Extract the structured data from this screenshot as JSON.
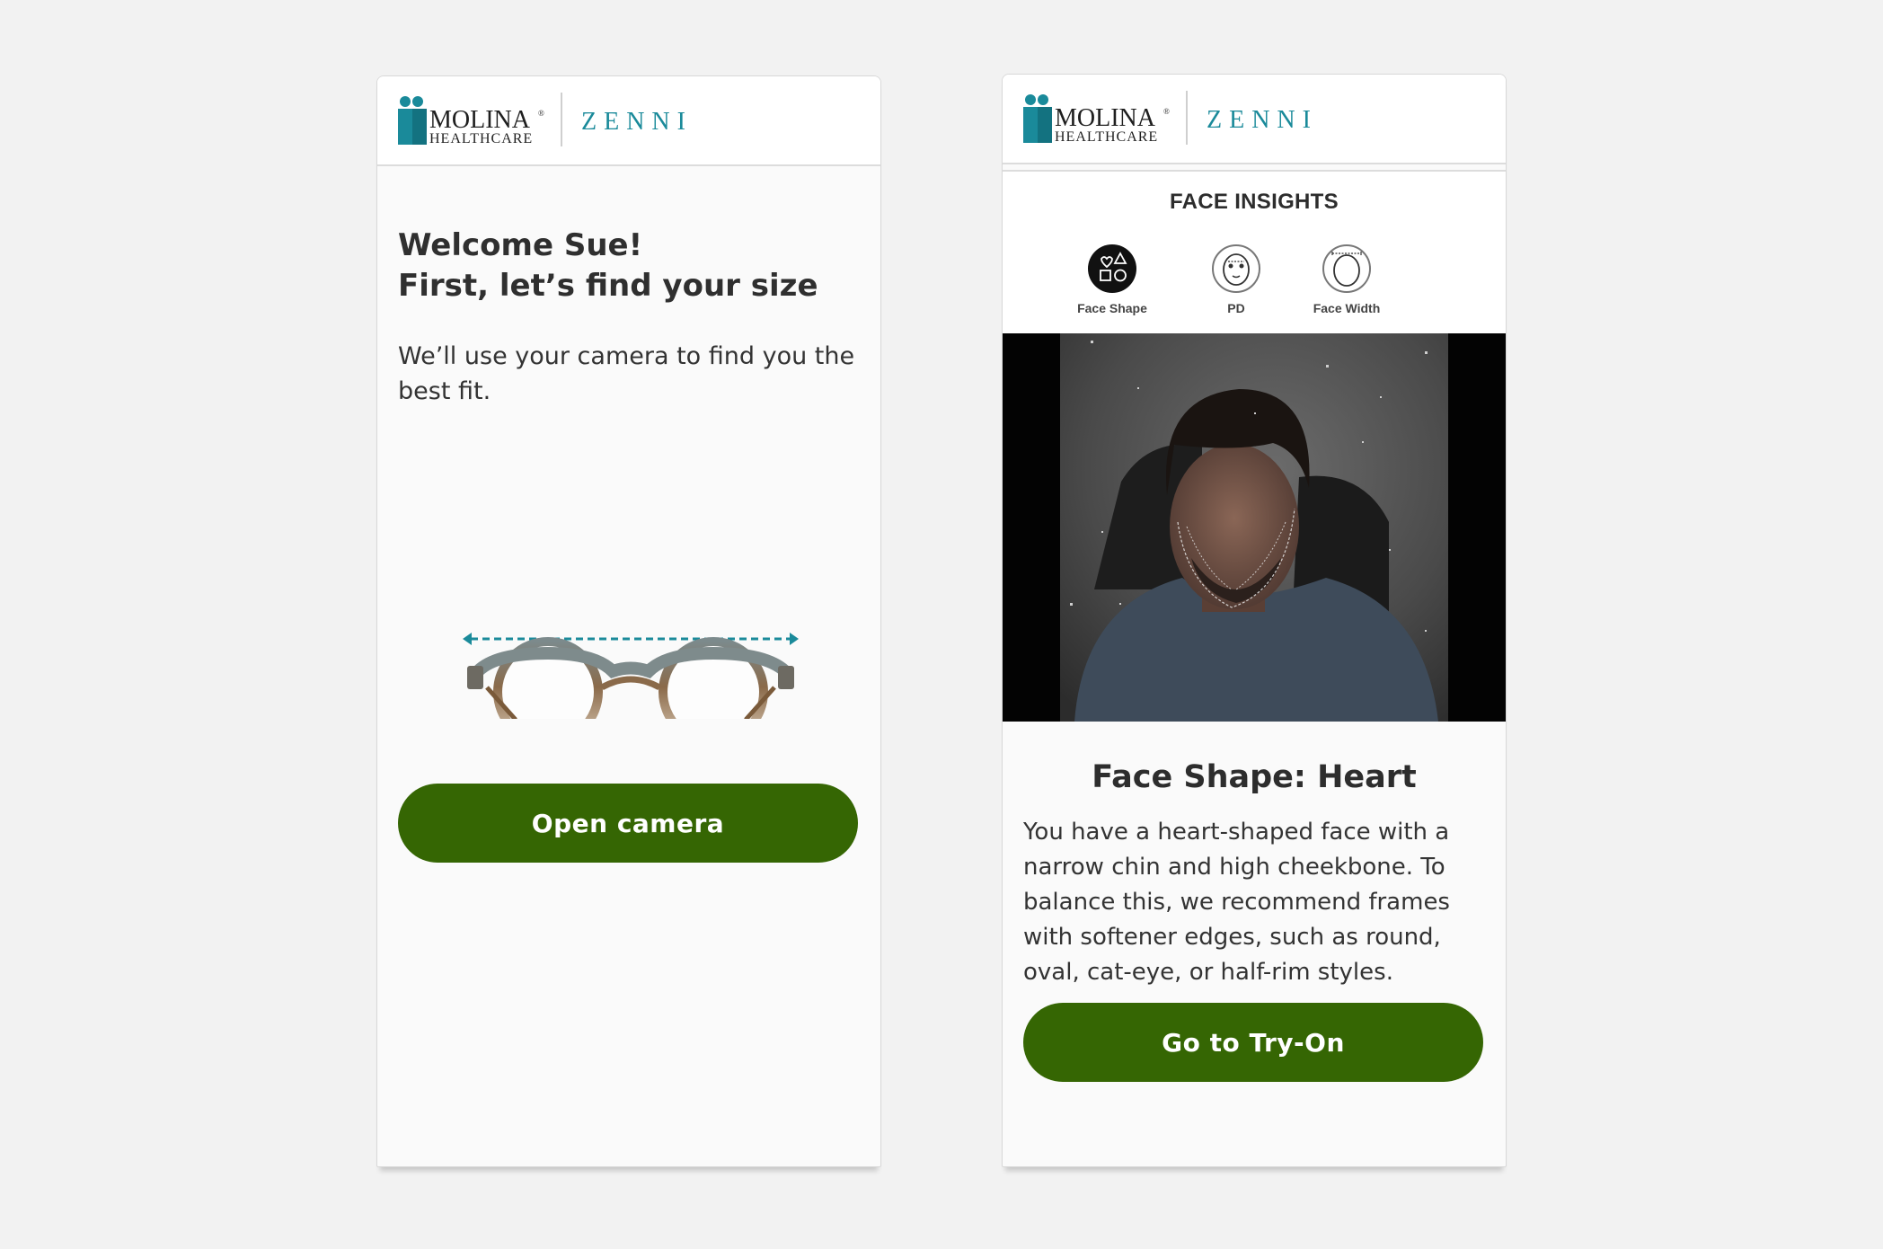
{
  "brand": {
    "molina_name": "MOLINA",
    "molina_sub": "HEALTHCARE",
    "molina_mark": "®",
    "zenni_name": "ZENNI",
    "teal": "#1a8a9a",
    "green": "#356603"
  },
  "left_screen": {
    "title_line1": "Welcome Sue!",
    "title_line2": "First, let’s find your size",
    "subtitle": "We’ll use your camera to find you the best fit.",
    "button_label": "Open camera"
  },
  "right_screen": {
    "insights_title": "FACE INSIGHTS",
    "tabs": [
      {
        "label": "Face Shape",
        "icon": "face-shape-icon",
        "active": true
      },
      {
        "label": "PD",
        "icon": "pd-icon",
        "active": false
      },
      {
        "label": "Face Width",
        "icon": "face-width-icon",
        "active": false
      }
    ],
    "result_heading": "Face Shape: Heart",
    "result_text": "You have a heart-shaped face with a narrow chin and high cheekbone. To balance this, we recommend frames with softener edges, such as round, oval, cat-eye, or half-rim styles.",
    "button_label": "Go to Try-On"
  }
}
